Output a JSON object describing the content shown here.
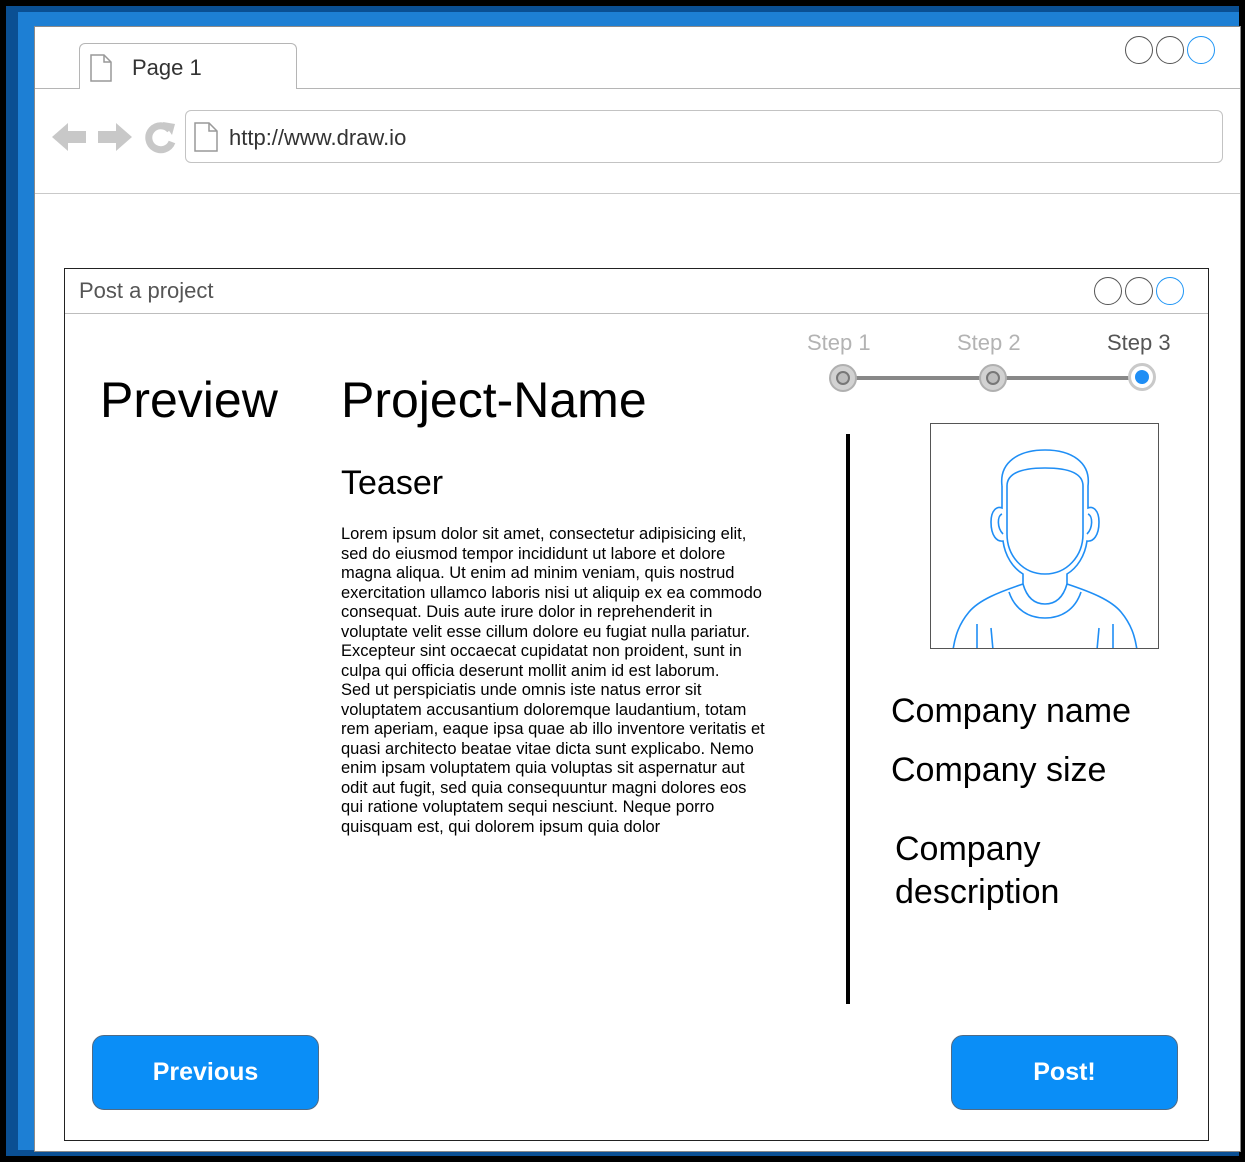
{
  "browser": {
    "tab_label": "Page 1",
    "url": "http://www.draw.io",
    "accent_color": "#1f95f5"
  },
  "dialog": {
    "title": "Post a project",
    "steps": [
      "Step 1",
      "Step 2",
      "Step 3"
    ],
    "current_step": 3
  },
  "preview": {
    "heading": "Preview",
    "project_name": "Project-Name",
    "teaser": "Teaser",
    "body_paragraphs": [
      "Lorem ipsum dolor sit amet, consectetur adipisicing elit, sed do eiusmod tempor incididunt ut labore et dolore magna aliqua. Ut enim ad minim veniam, quis nostrud exercitation ullamco laboris nisi ut aliquip ex ea commodo consequat. Duis aute irure dolor in reprehenderit in voluptate velit esse cillum dolore eu fugiat nulla pariatur. Excepteur sint occaecat cupidatat non proident, sunt in culpa qui officia deserunt mollit anim id est laborum.",
      "Sed ut perspiciatis unde omnis iste natus error sit voluptatem accusantium doloremque laudantium, totam rem aperiam, eaque ipsa quae ab illo inventore veritatis et quasi architecto beatae vitae dicta sunt explicabo. Nemo enim ipsam voluptatem quia voluptas sit aspernatur aut odit aut fugit, sed quia consequuntur magni dolores eos qui ratione voluptatem sequi nesciunt. Neque porro quisquam est, qui dolorem ipsum quia dolor"
    ]
  },
  "company": {
    "avatar_icon": "user-avatar-icon",
    "name_label": "Company name",
    "size_label": "Company size",
    "description_label": "Company description"
  },
  "buttons": {
    "previous_label": "Previous",
    "post_label": "Post!",
    "color": "#0a8ef7"
  }
}
